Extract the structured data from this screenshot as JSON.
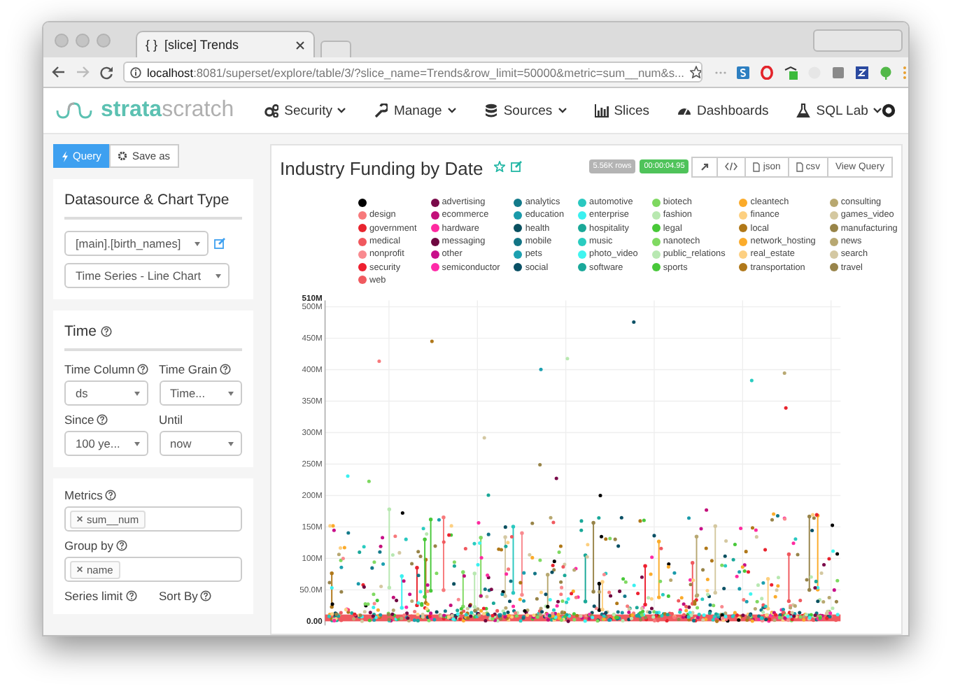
{
  "browser": {
    "tab_icon": "{ }",
    "tab_title": "[slice] Trends",
    "url": "**localhost**:8081/superset/explore/table/3/?slice_name=Trends&row_limit=50000&metric=sum__num&s..."
  },
  "navbar": {
    "logo": "**strata**scratch",
    "items": [
      {
        "label": "Security",
        "caret": true
      },
      {
        "label": "Manage",
        "caret": true
      },
      {
        "label": "Sources",
        "caret": true
      },
      {
        "label": "Slices",
        "caret": false
      },
      {
        "label": "Dashboards",
        "caret": false
      },
      {
        "label": "SQL Lab",
        "caret": true
      }
    ]
  },
  "sidebar": {
    "buttons": [
      {
        "label": "Query",
        "selected": true
      },
      {
        "label": "Save as",
        "selected": false
      }
    ],
    "panels": [
      {
        "title": "Datasource & Chart Type",
        "help": false,
        "rows": [
          [
            {
              "kind": "select",
              "value": "[main].[birth_names]",
              "edit": true
            }
          ],
          [
            {
              "kind": "select",
              "value": "Time Series - Line Chart",
              "edit": false
            }
          ]
        ]
      },
      {
        "title": "Time",
        "help": true,
        "rows": [
          [
            {
              "kind": "select",
              "label": "Time Column",
              "help": true,
              "value": "ds",
              "edit": false
            },
            {
              "kind": "select",
              "label": "Time Grain",
              "help": true,
              "value": "Time...",
              "edit": false
            }
          ],
          [
            {
              "kind": "select",
              "label": "Since",
              "help": true,
              "value": "100 ye...",
              "edit": false
            },
            {
              "kind": "select",
              "label": "Until",
              "help": false,
              "value": "now",
              "edit": false
            }
          ]
        ]
      },
      {
        "rows": [
          [
            {
              "kind": "tags",
              "label": "Metrics",
              "help": true,
              "tags": [
                "sum__num"
              ]
            }
          ],
          [
            {
              "kind": "tags",
              "label": "Group by",
              "help": true,
              "tags": [
                "name"
              ]
            }
          ],
          [
            {
              "kind": "label",
              "label": "Series limit",
              "help": true
            },
            {
              "kind": "label",
              "label": "Sort By",
              "help": true
            }
          ]
        ]
      }
    ]
  },
  "chart_panel": {
    "title": "Industry Funding by Date",
    "starred": false,
    "badges": [
      {
        "kind": "rows",
        "text": "5.56K rows"
      },
      {
        "kind": "time",
        "text": "00:00:04.95"
      }
    ],
    "buttons": [
      "json",
      "csv",
      "View Query"
    ],
    "legend": [
      {
        "color": "#000000"
      },
      {
        "label": "advertising",
        "color": "#7a0a4a"
      },
      {
        "label": "analytics",
        "color": "#137a8a"
      },
      {
        "label": "automotive",
        "color": "#2ac8c0"
      },
      {
        "label": "biotech",
        "color": "#7ed860"
      },
      {
        "label": "cleantech",
        "color": "#fbab2a"
      },
      {
        "label": "consulting",
        "color": "#b8a870"
      },
      {
        "label": "design",
        "color": "#f7797b"
      },
      {
        "label": "ecommerce",
        "color": "#c3107a"
      },
      {
        "label": "education",
        "color": "#1a9aaa"
      },
      {
        "label": "enterprise",
        "color": "#3af0f0"
      },
      {
        "label": "fashion",
        "color": "#b8e8b0"
      },
      {
        "label": "finance",
        "color": "#fdd080"
      },
      {
        "label": "games_video",
        "color": "#d4c8a0"
      },
      {
        "label": "government",
        "color": "#e8242e"
      },
      {
        "label": "hardware",
        "color": "#ff2aa0"
      },
      {
        "label": "health",
        "color": "#0a5060"
      },
      {
        "label": "hospitality",
        "color": "#1aa898"
      },
      {
        "label": "legal",
        "color": "#48c838"
      },
      {
        "label": "local",
        "color": "#b07818"
      },
      {
        "label": "manufacturing",
        "color": "#988448"
      },
      {
        "label": "medical",
        "color": "#f0585e"
      },
      {
        "label": "messaging",
        "color": "#6e0840"
      },
      {
        "label": "mobile",
        "color": "#137585"
      },
      {
        "label": "music",
        "color": "#2accc0"
      },
      {
        "label": "nanotech",
        "color": "#80da62"
      },
      {
        "label": "network_hosting",
        "color": "#fbac2c"
      },
      {
        "label": "news",
        "color": "#b8a872"
      },
      {
        "label": "nonprofit",
        "color": "#f98a8f"
      },
      {
        "label": "other",
        "color": "#c8108a"
      },
      {
        "label": "pets",
        "color": "#1ca0b0"
      },
      {
        "label": "photo_video",
        "color": "#40f5f0"
      },
      {
        "label": "public_relations",
        "color": "#b8e8b2"
      },
      {
        "label": "real_estate",
        "color": "#fdd082"
      },
      {
        "label": "search",
        "color": "#d4c8a2"
      },
      {
        "label": "security",
        "color": "#ee2030"
      },
      {
        "label": "semiconductor",
        "color": "#ff2aa8"
      },
      {
        "label": "social",
        "color": "#0a5065"
      },
      {
        "label": "software",
        "color": "#1aa89a"
      },
      {
        "label": "sports",
        "color": "#48c83a"
      },
      {
        "label": "transportation",
        "color": "#b0781a"
      },
      {
        "label": "travel",
        "color": "#98844a"
      },
      {
        "label": "web",
        "color": "#f05a5f"
      }
    ],
    "axis_labels": [
      "510M",
      "500M",
      "450M",
      "400M",
      "350M",
      "300M",
      "250M",
      "200M",
      "150M",
      "100M",
      "50.0M",
      "0.00"
    ]
  }
}
